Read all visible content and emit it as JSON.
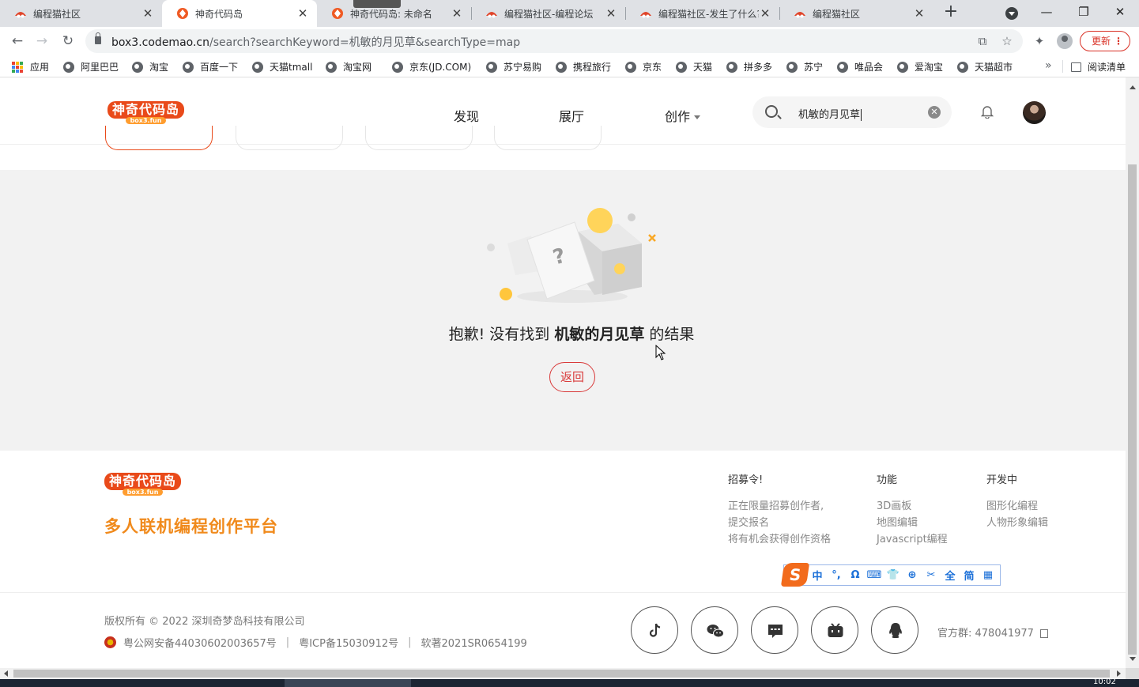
{
  "browser": {
    "tabs": [
      {
        "title": "编程猫社区",
        "active": false,
        "favicon": "codemao-favicon"
      },
      {
        "title": "神奇代码岛",
        "active": true,
        "favicon": "box3-favicon"
      },
      {
        "title": "神奇代码岛: 未命名",
        "active": false,
        "favicon": "box3-favicon"
      },
      {
        "title": "编程猫社区-编程论坛",
        "active": false,
        "favicon": "codemao-favicon"
      },
      {
        "title": "编程猫社区-发生了什么?",
        "active": false,
        "favicon": "codemao-favicon"
      },
      {
        "title": "编程猫社区",
        "active": false,
        "favicon": "codemao-favicon"
      }
    ],
    "new_tab_label": "+",
    "url_host": "box3.codemao.cn",
    "url_path": "/search?searchKeyword=机敏的月见草&searchType=map",
    "update_label": "更新",
    "bookmarks": [
      {
        "label": "应用",
        "icon": "apps-grid-icon"
      },
      {
        "label": "阿里巴巴",
        "icon": "globe-icon"
      },
      {
        "label": "淘宝",
        "icon": "globe-icon"
      },
      {
        "label": "百度一下",
        "icon": "globe-icon"
      },
      {
        "label": "天猫tmall",
        "icon": "globe-icon"
      },
      {
        "label": "淘宝网",
        "icon": "globe-icon"
      },
      {
        "label": "京东(JD.COM)",
        "icon": "globe-icon"
      },
      {
        "label": "苏宁易购",
        "icon": "globe-icon"
      },
      {
        "label": "携程旅行",
        "icon": "globe-icon"
      },
      {
        "label": "京东",
        "icon": "globe-icon"
      },
      {
        "label": "天猫",
        "icon": "globe-icon"
      },
      {
        "label": "拼多多",
        "icon": "globe-icon"
      },
      {
        "label": "苏宁",
        "icon": "globe-icon"
      },
      {
        "label": "唯品会",
        "icon": "globe-icon"
      },
      {
        "label": "爱淘宝",
        "icon": "globe-icon"
      },
      {
        "label": "天猫超市",
        "icon": "globe-icon"
      }
    ],
    "bookmarks_overflow": "»",
    "reading_list_label": "阅读清单"
  },
  "header": {
    "logo_cn": "神奇代码岛",
    "logo_en": "box3.fun",
    "nav": [
      {
        "label": "发现"
      },
      {
        "label": "展厅"
      },
      {
        "label": "创作"
      }
    ],
    "search_value": "机敏的月见草"
  },
  "empty_state": {
    "prefix": "抱歉! 没有找到 ",
    "keyword": "机敏的月见草",
    "suffix": " 的结果",
    "back_label": "返回"
  },
  "footer": {
    "logo_cn": "神奇代码岛",
    "logo_en": "box3.fun",
    "tagline": "多人联机编程创作平台",
    "columns": [
      {
        "heading": "招募令!",
        "items": [
          "正在限量招募创作者,",
          "提交报名",
          "将有机会获得创作资格"
        ]
      },
      {
        "heading": "功能",
        "items": [
          "3D画板",
          "地图编辑",
          "Javascript编程"
        ]
      },
      {
        "heading": "开发中",
        "items": [
          "图形化编程",
          "人物形象编辑"
        ]
      }
    ],
    "copyright": "版权所有 © 2022 深圳奇梦岛科技有限公司",
    "beian_police": "粤公网安备44030602003657号",
    "beian_icp": "粤ICP备15030912号",
    "beian_soft": "软著2021SR0654199",
    "separator": "|",
    "official_group_label": "官方群: ",
    "official_group_number": "478041977",
    "social_icons": [
      "tiktok-icon",
      "wechat-icon",
      "message-icon",
      "bilibili-icon",
      "qq-icon"
    ]
  },
  "ime_toolbar": {
    "logo": "S",
    "items": [
      "中",
      "°,",
      "Ω",
      "⌨",
      "👕",
      "⊕",
      "✂",
      "全",
      "简",
      "▦"
    ]
  },
  "taskbar": {
    "clock": "10:02"
  },
  "colors": {
    "brand_red": "#e94a1a",
    "brand_orange": "#f08a1c",
    "back_button_red": "#d93a3a",
    "page_bg": "#f2f2f2",
    "ime_blue": "#1a6fd8"
  }
}
